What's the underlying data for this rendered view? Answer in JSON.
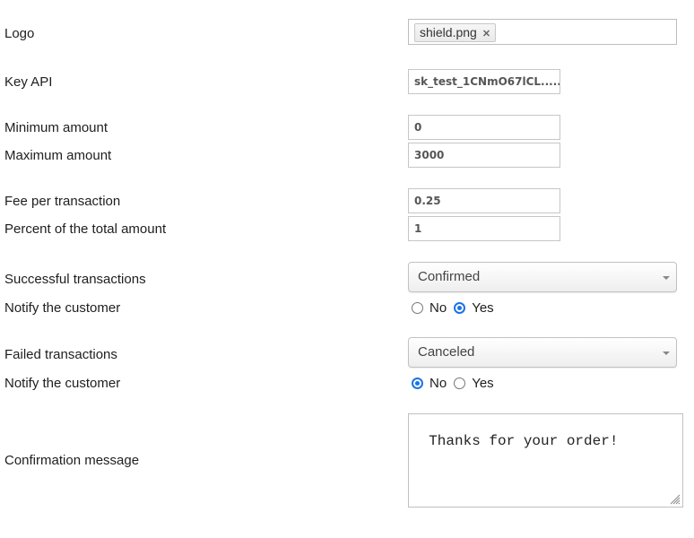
{
  "form": {
    "logo": {
      "label": "Logo",
      "tags": [
        {
          "name": "shield.png",
          "remove_icon": "close-icon"
        }
      ]
    },
    "key_api": {
      "label": "Key API",
      "value": "sk_test_1CNmO67lCL....."
    },
    "minimum_amount": {
      "label": "Minimum amount",
      "value": "0"
    },
    "maximum_amount": {
      "label": "Maximum amount",
      "value": "3000"
    },
    "fee_per_transaction": {
      "label": "Fee per transaction",
      "value": "0.25"
    },
    "percent_total": {
      "label": "Percent of the total amount",
      "value": "1"
    },
    "successful_transactions": {
      "label": "Successful transactions",
      "selected": "Confirmed"
    },
    "notify_success": {
      "label": "Notify the customer",
      "options": [
        "No",
        "Yes"
      ],
      "selected": "Yes"
    },
    "failed_transactions": {
      "label": "Failed transactions",
      "selected": "Canceled"
    },
    "notify_failed": {
      "label": "Notify the customer",
      "options": [
        "No",
        "Yes"
      ],
      "selected": "No"
    },
    "confirmation_message": {
      "label": "Confirmation message",
      "value": "Thanks for your order!"
    }
  },
  "colors": {
    "accent": "#1a73e8",
    "border": "#c6c6c6"
  }
}
